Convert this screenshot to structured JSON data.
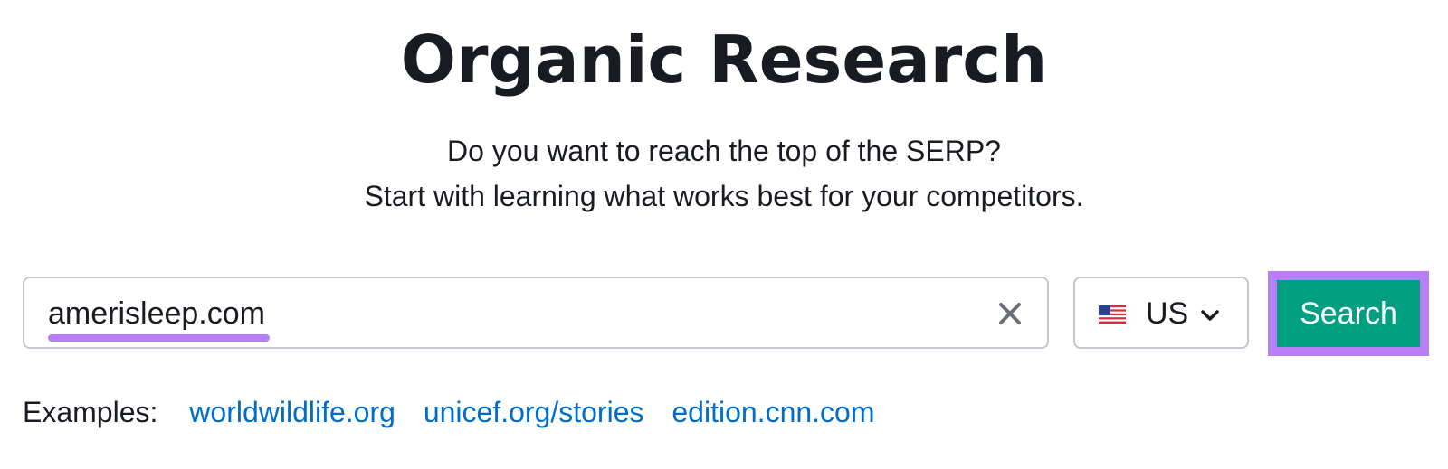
{
  "header": {
    "title": "Organic Research",
    "subtitle_line1": "Do you want to reach the top of the SERP?",
    "subtitle_line2": "Start with learning what works best for your competitors."
  },
  "search": {
    "value": "amerisleep.com",
    "clear_icon": "close-icon"
  },
  "country": {
    "label": "US",
    "flag_icon": "us-flag-icon",
    "chevron_icon": "chevron-down-icon"
  },
  "search_button": {
    "label": "Search"
  },
  "examples": {
    "label": "Examples:",
    "links": [
      "worldwildlife.org",
      "unicef.org/stories",
      "edition.cnn.com"
    ]
  },
  "colors": {
    "accent_green": "#009f81",
    "highlight_purple": "#b77ef6",
    "link_blue": "#006dca",
    "text_dark": "#191b23",
    "border_gray": "#c4c7cf"
  }
}
